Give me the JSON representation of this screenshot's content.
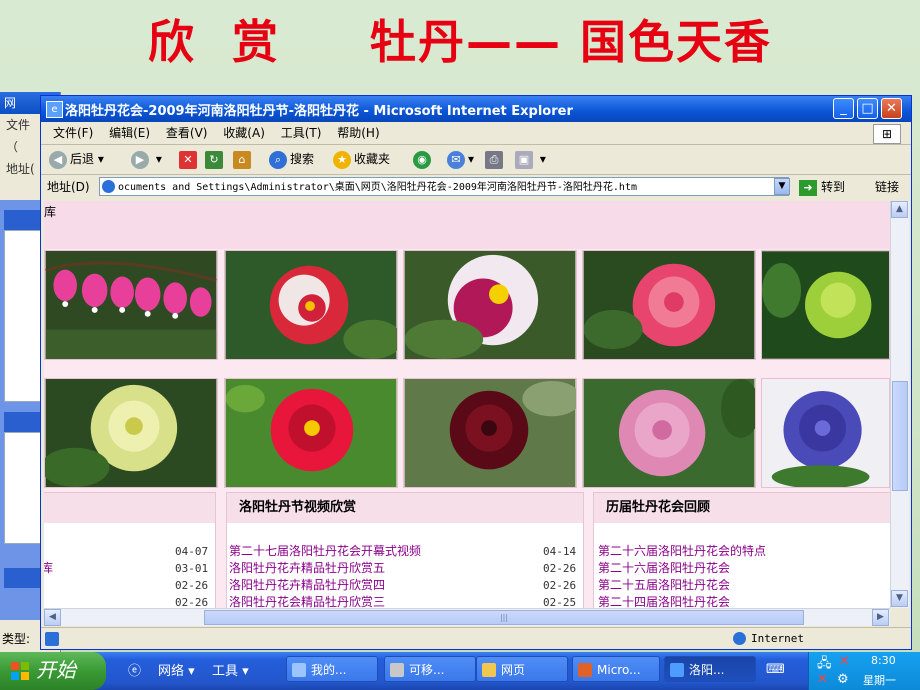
{
  "slide": {
    "title": "欣  赏     牡丹—— 国色天香"
  },
  "bg_window": {
    "title": "网",
    "menu": "文件",
    "nav": "（",
    "address_label": "地址(",
    "status_label": "类型:"
  },
  "ie": {
    "title": "洛阳牡丹花会-2009年河南洛阳牡丹节-洛阳牡丹花 - Microsoft Internet Explorer",
    "menu": [
      "文件(F)",
      "编辑(E)",
      "查看(V)",
      "收藏(A)",
      "工具(T)",
      "帮助(H)"
    ],
    "toolbar": {
      "back": "后退",
      "search": "搜索",
      "favorites": "收藏夹"
    },
    "address": {
      "label": "地址(D)",
      "value": "ocuments and Settings\\Administrator\\桌面\\网页\\洛阳牡丹花会-2009年河南洛阳牡丹节-洛阳牡丹花.htm",
      "go": "转到",
      "links": "链接"
    },
    "status": {
      "zone": "Internet"
    }
  },
  "page": {
    "head_fragment": "库",
    "left_panel": {
      "dates": [
        "04-07",
        "03-01",
        "02-26",
        "02-26"
      ],
      "fragment": "库"
    },
    "video_panel": {
      "title": "洛阳牡丹节视频欣赏",
      "items": [
        {
          "title": "第二十七届洛阳牡丹花会开幕式视频",
          "date": "04-14"
        },
        {
          "title": "洛阳牡丹花卉精品牡丹欣赏五",
          "date": "02-26"
        },
        {
          "title": "洛阳牡丹花卉精品牡丹欣赏四",
          "date": "02-26"
        },
        {
          "title": "洛阳牡丹花会精品牡丹欣赏三",
          "date": "02-25"
        }
      ]
    },
    "history_panel": {
      "title": "历届牡丹花会回顾",
      "items": [
        "第二十六届洛阳牡丹花会的特点",
        "第二十六届洛阳牡丹花会",
        "第二十五届洛阳牡丹花会",
        "第二十四届洛阳牡丹花会"
      ]
    }
  },
  "taskbar": {
    "start": "开始",
    "quick": [
      "网络",
      "工具"
    ],
    "tasks": [
      "我的...",
      "可移...",
      "网页",
      "Micro...",
      "洛阳..."
    ],
    "time": "8:30",
    "day": "星期一"
  },
  "colors": {
    "title_red": "#e60012",
    "link_purple": "#8a008a",
    "page_pink": "#fbe8f1"
  }
}
